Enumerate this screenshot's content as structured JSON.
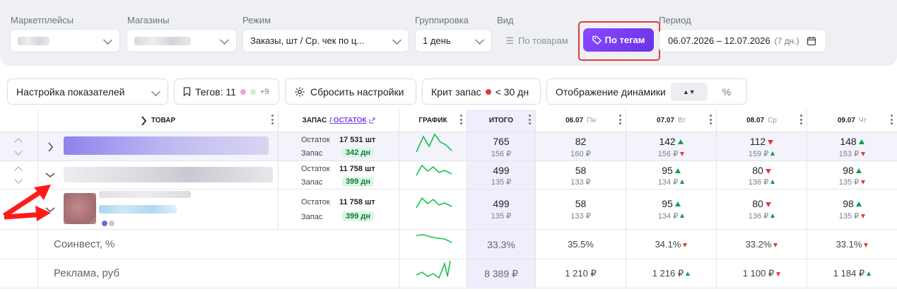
{
  "filters": {
    "marketplaces_label": "Маркетплейсы",
    "shops_label": "Магазины",
    "mode_label": "Режим",
    "mode_value": "Заказы, шт / Ср. чек по ц...",
    "grouping_label": "Группировка",
    "grouping_value": "1 день",
    "view_label": "Вид",
    "by_products": "По товарам",
    "by_tags": "По тегам",
    "period_label": "Период",
    "period_value": "06.07.2026 – 12.07.2026",
    "period_days": "(7 дн.)"
  },
  "toolbar": {
    "settings": "Настройка показателей",
    "tags": "Тегов: 11",
    "tags_more": "+9",
    "reset": "Сбросить настройки",
    "crit_label": "Крит запас",
    "crit_value": "< 30 дн",
    "dynamics": "Отображение динамики",
    "percent": "%"
  },
  "columns": {
    "product": "ТОВАР",
    "stock": "ЗАПАС",
    "stock_link": "/ ОСТАТОК",
    "chart": "ГРАФИК",
    "total": "ИТОГО",
    "days": [
      {
        "date": "06.07",
        "dow": "Пн"
      },
      {
        "date": "07.07",
        "dow": "Вт"
      },
      {
        "date": "08.07",
        "dow": "Ср"
      },
      {
        "date": "09.07",
        "dow": "Чт"
      }
    ]
  },
  "labels": {
    "ostatok": "Остаток",
    "zapas": "Запас"
  },
  "rows": [
    {
      "ostatok": "17 531 шт",
      "zapas": "342 дн",
      "total": "765",
      "total_sub": "156 ₽",
      "days": [
        {
          "v": "82",
          "s": "160 ₽",
          "vd": "",
          "sd": ""
        },
        {
          "v": "142",
          "s": "156 ₽",
          "vd": "up",
          "sd": "down"
        },
        {
          "v": "112",
          "s": "159 ₽",
          "vd": "down",
          "sd": "up"
        },
        {
          "v": "148",
          "s": "153 ₽",
          "vd": "up",
          "sd": "down"
        }
      ]
    },
    {
      "ostatok": "11 758 шт",
      "zapas": "399 дн",
      "total": "499",
      "total_sub": "135 ₽",
      "days": [
        {
          "v": "58",
          "s": "133 ₽",
          "vd": "",
          "sd": ""
        },
        {
          "v": "95",
          "s": "134 ₽",
          "vd": "up",
          "sd": "up"
        },
        {
          "v": "80",
          "s": "136 ₽",
          "vd": "down",
          "sd": "up"
        },
        {
          "v": "98",
          "s": "135 ₽",
          "vd": "up",
          "sd": "down"
        }
      ]
    },
    {
      "ostatok": "11 758 шт",
      "zapas": "399 дн",
      "total": "499",
      "total_sub": "135 ₽",
      "days": [
        {
          "v": "58",
          "s": "133 ₽",
          "vd": "",
          "sd": ""
        },
        {
          "v": "95",
          "s": "134 ₽",
          "vd": "up",
          "sd": "up"
        },
        {
          "v": "80",
          "s": "136 ₽",
          "vd": "down",
          "sd": "up"
        },
        {
          "v": "98",
          "s": "135 ₽",
          "vd": "up",
          "sd": "down"
        }
      ]
    }
  ],
  "summary": [
    {
      "label": "Соинвест, %",
      "total": "33.3%",
      "days": [
        {
          "v": "35.5%",
          "d": ""
        },
        {
          "v": "34.1%",
          "d": "down"
        },
        {
          "v": "33.2%",
          "d": "down"
        },
        {
          "v": "33.1%",
          "d": "down"
        }
      ]
    },
    {
      "label": "Реклама, руб",
      "total": "8 389 ₽",
      "days": [
        {
          "v": "1 210 ₽",
          "d": ""
        },
        {
          "v": "1 216 ₽",
          "d": "up"
        },
        {
          "v": "1 100 ₽",
          "d": "down"
        },
        {
          "v": "1 184 ₽",
          "d": "up"
        }
      ]
    }
  ],
  "colors": {
    "accent": "#7b3ff2",
    "up": "#149a48",
    "down": "#e53935",
    "spark": "#17c24a",
    "highlight_red": "#e53935"
  },
  "icons": [
    "chevron-down-icon",
    "list-icon",
    "tag-icon",
    "calendar-icon",
    "bookmark-icon",
    "gear-icon",
    "external-link-icon",
    "kebab-icon",
    "sort-arrows-icon",
    "chevron-right-icon",
    "arrow-annotation-icon"
  ]
}
